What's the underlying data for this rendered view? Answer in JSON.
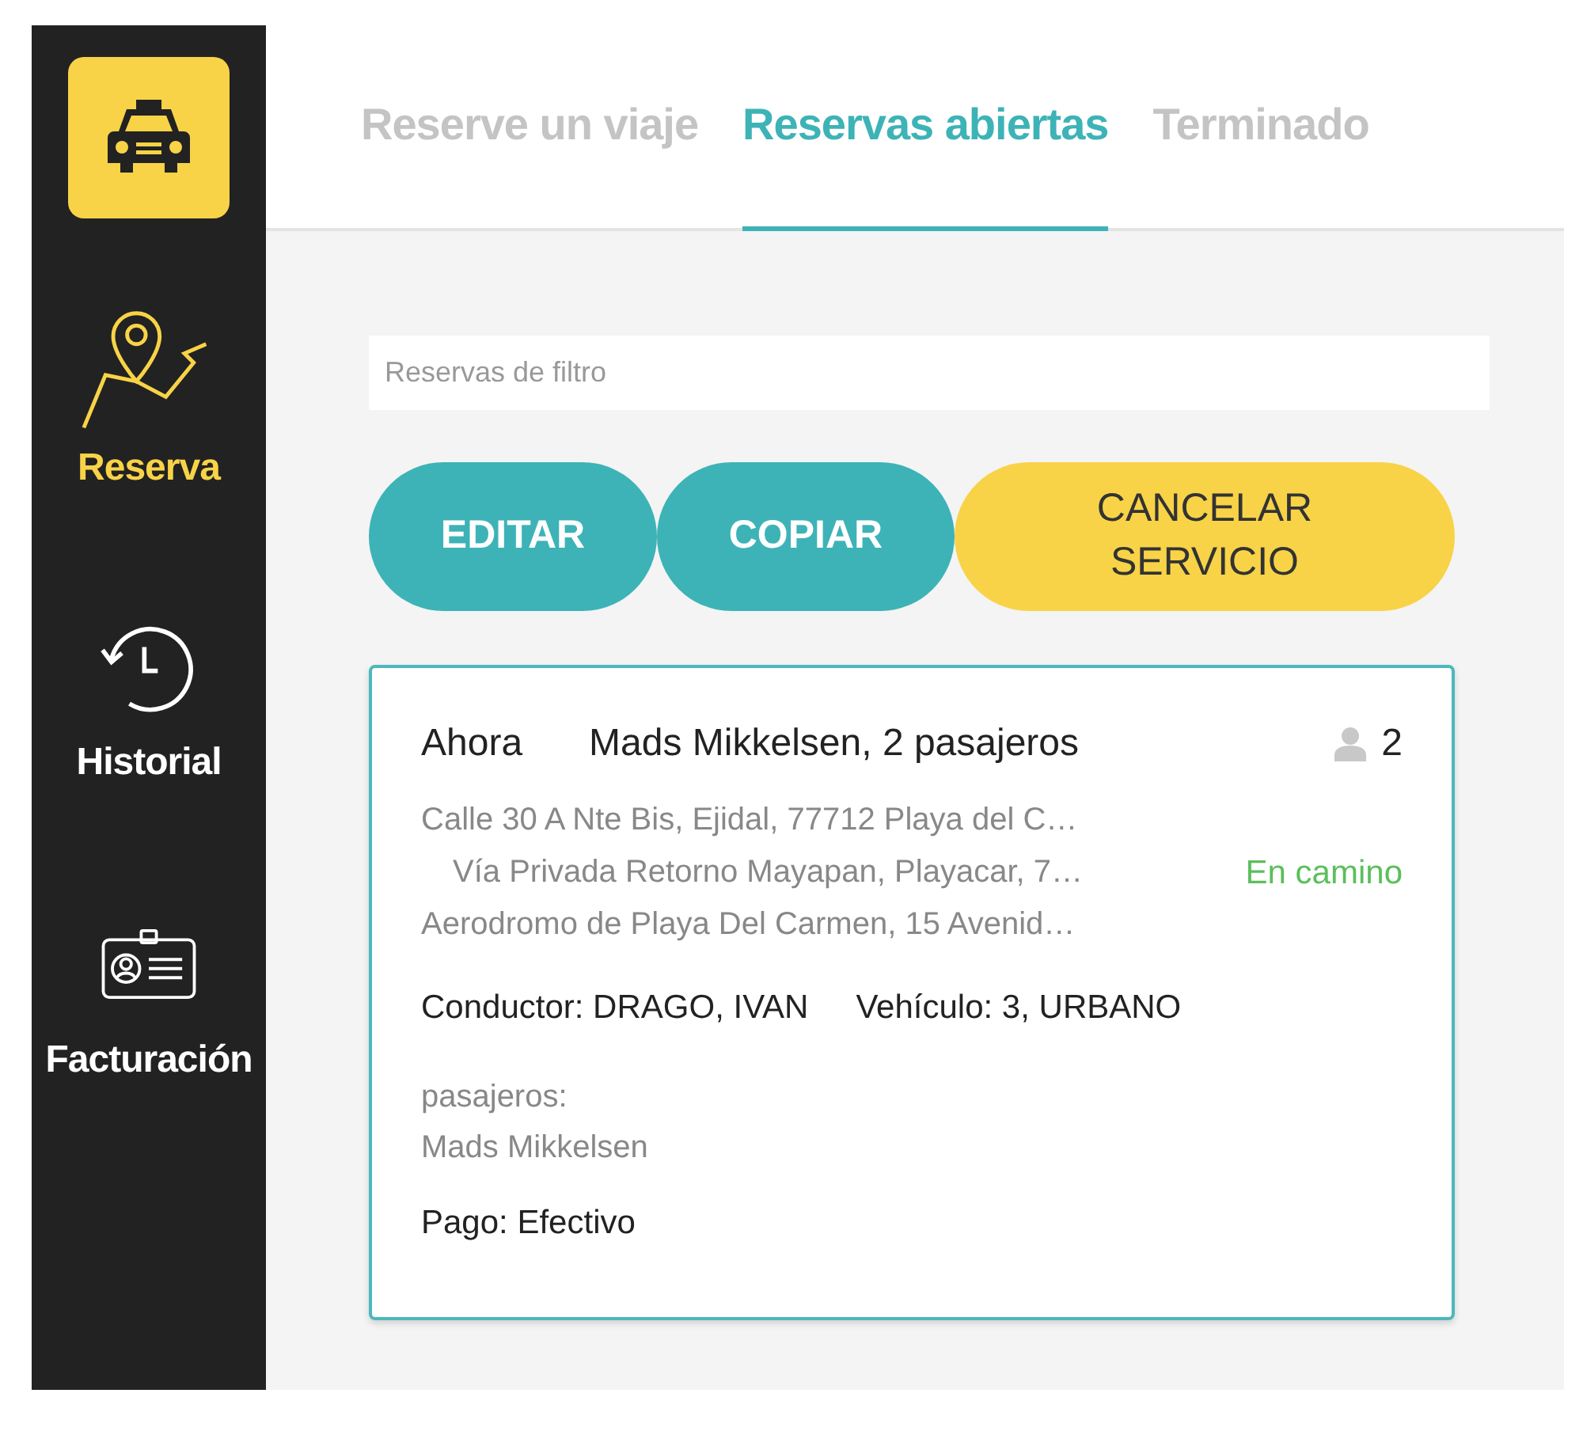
{
  "sidebar": {
    "items": [
      {
        "label": "Reserva",
        "kind": "route",
        "selected": true
      },
      {
        "label": "Historial",
        "kind": "history",
        "selected": false
      },
      {
        "label": "Facturación",
        "kind": "badge",
        "selected": false
      }
    ]
  },
  "tabs": [
    {
      "label": "Reserve un viaje",
      "selected": false
    },
    {
      "label": "Reservas abiertas",
      "selected": true
    },
    {
      "label": "Terminado",
      "selected": false
    }
  ],
  "filter": {
    "placeholder": "Reservas de filtro"
  },
  "buttons": [
    {
      "label": "EDITAR",
      "kind": "primary"
    },
    {
      "label": "COPIAR",
      "kind": "primary"
    },
    {
      "label": "CANCELAR SERVICIO",
      "kind": "warning"
    }
  ],
  "booking": {
    "time": "Ahora",
    "title": "Mads Mikkelsen, 2 pasajeros",
    "passenger_count": "2",
    "stops": [
      {
        "address": "Calle 30 A Nte Bis, Ejidal, 77712 Playa del C…",
        "kind": "origin"
      },
      {
        "address": "Vía Privada Retorno Mayapan, Playacar, 7…",
        "kind": "waypoint"
      },
      {
        "address": "Aerodromo de Playa Del Carmen, 15 Avenid…",
        "kind": "destination"
      }
    ],
    "status": "En camino",
    "driver": "Conductor: DRAGO, IVAN",
    "vehicle": "Vehículo: 3, URBANO",
    "passengers_label": "pasajeros:",
    "passengers": [
      "Mads Mikkelsen"
    ],
    "payment": "Pago: Efectivo"
  }
}
